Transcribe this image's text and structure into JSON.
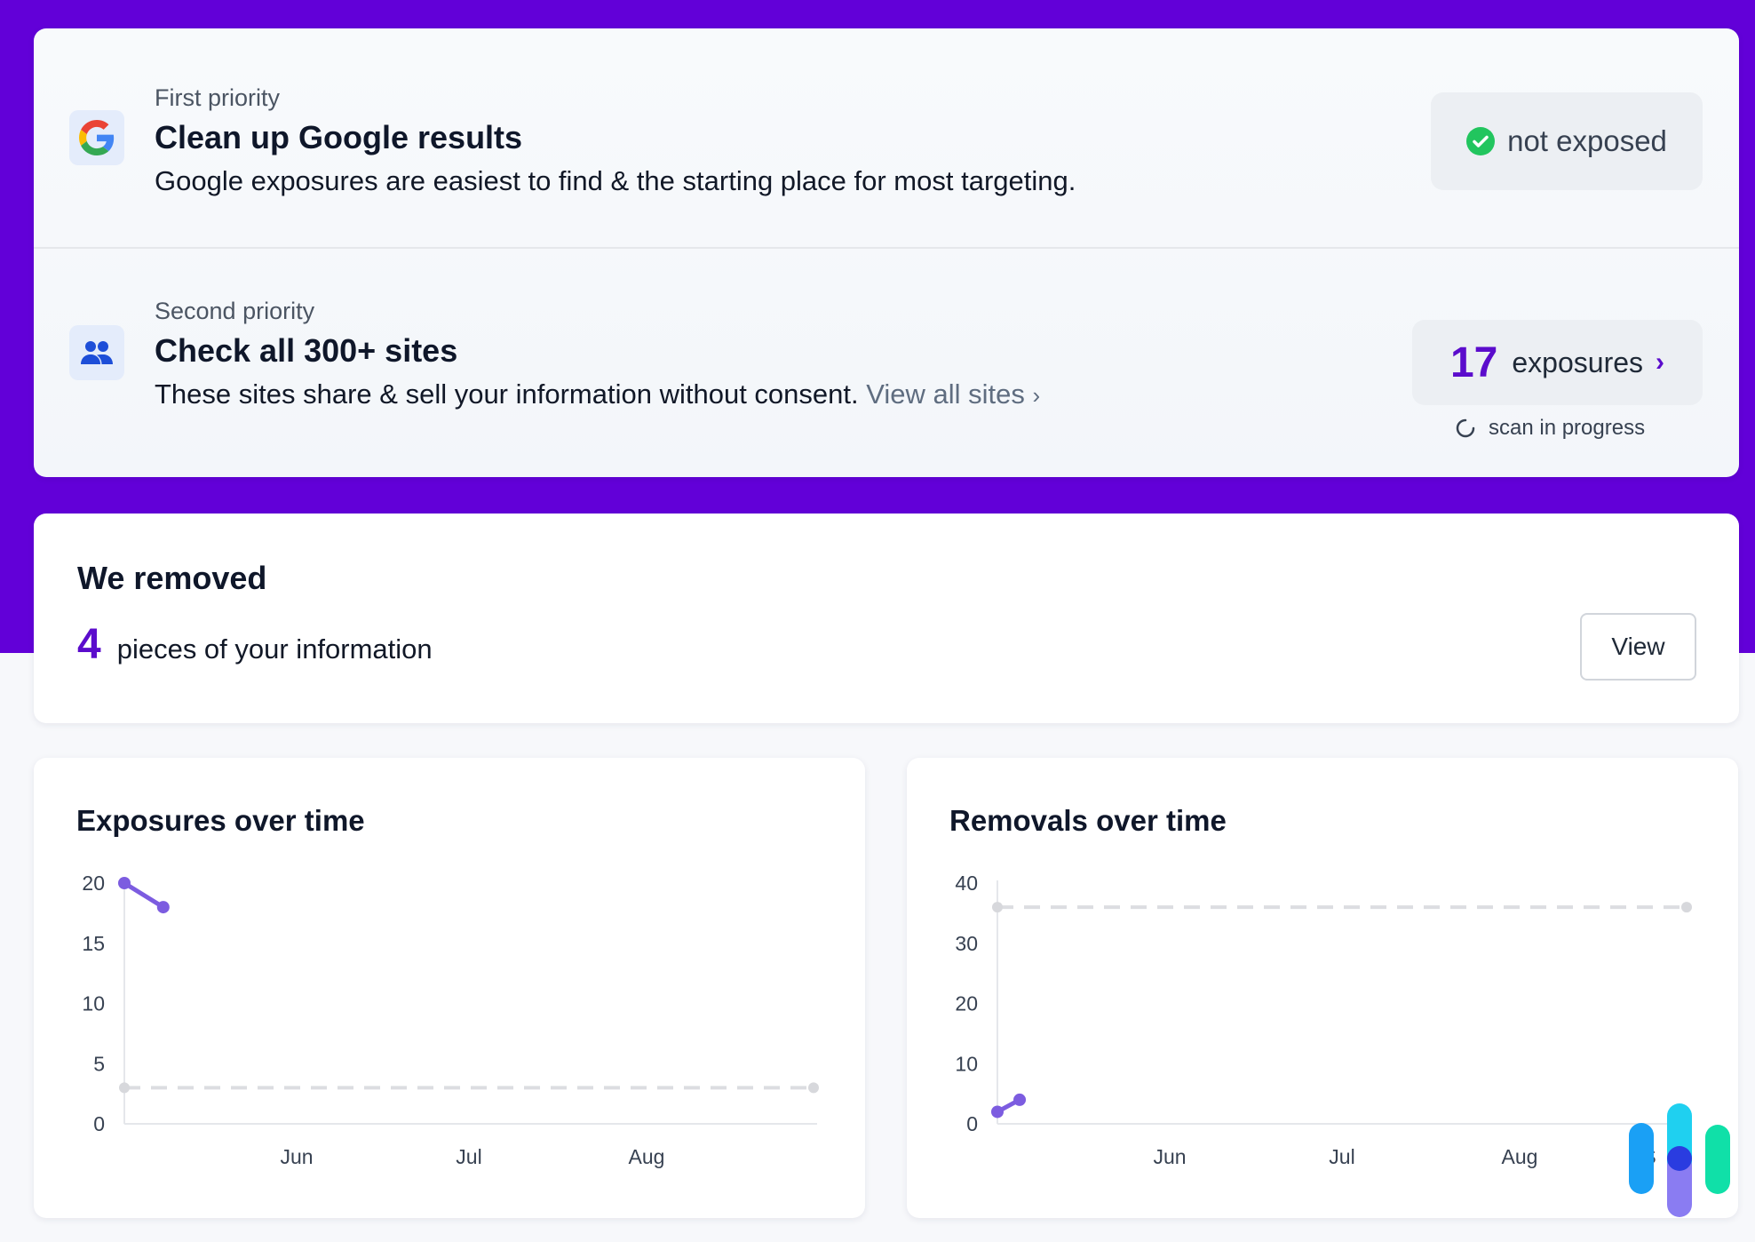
{
  "priorities": [
    {
      "label": "First priority",
      "title": "Clean up Google results",
      "description": "Google exposures are easiest to find & the starting place for most targeting.",
      "icon": "google-icon",
      "status": {
        "text": "not exposed",
        "icon": "check-circle-icon",
        "color": "#22c55e"
      }
    },
    {
      "label": "Second priority",
      "title": "Check all 300+ sites",
      "description": "These sites share & sell your information without consent.",
      "link": "View all sites",
      "icon": "people-icon",
      "exposures": {
        "count": "17",
        "label": "exposures",
        "chevron": "›"
      },
      "scan_text": "scan in progress"
    }
  ],
  "removed": {
    "title": "We removed",
    "count": "4",
    "text": "pieces of your information",
    "button": "View"
  },
  "colors": {
    "brand_purple": "#6200d8",
    "accent": "#5b0ccc",
    "series": "#7c5ce0"
  },
  "chart_data": [
    {
      "type": "line",
      "title": "Exposures over time",
      "ylim": [
        0,
        20
      ],
      "yticks": [
        "0",
        "5",
        "10",
        "15",
        "20"
      ],
      "xticks": [
        "Jun",
        "Jul",
        "Aug"
      ],
      "grid": false,
      "series": [
        {
          "points": [
            {
              "x": "May 1",
              "y": 20
            },
            {
              "x": "May 8",
              "y": 18
            }
          ]
        }
      ],
      "reference_line": {
        "y": 3,
        "style": "dashed"
      }
    },
    {
      "type": "line",
      "title": "Removals over time",
      "ylim": [
        0,
        40
      ],
      "yticks": [
        "0",
        "10",
        "20",
        "30",
        "40"
      ],
      "xticks": [
        "Jun",
        "Jul",
        "Aug",
        "S"
      ],
      "grid": false,
      "series": [
        {
          "points": [
            {
              "x": "May 1",
              "y": 2
            },
            {
              "x": "May 5",
              "y": 4
            }
          ]
        }
      ],
      "reference_line": {
        "y": 36,
        "style": "dashed"
      }
    }
  ]
}
